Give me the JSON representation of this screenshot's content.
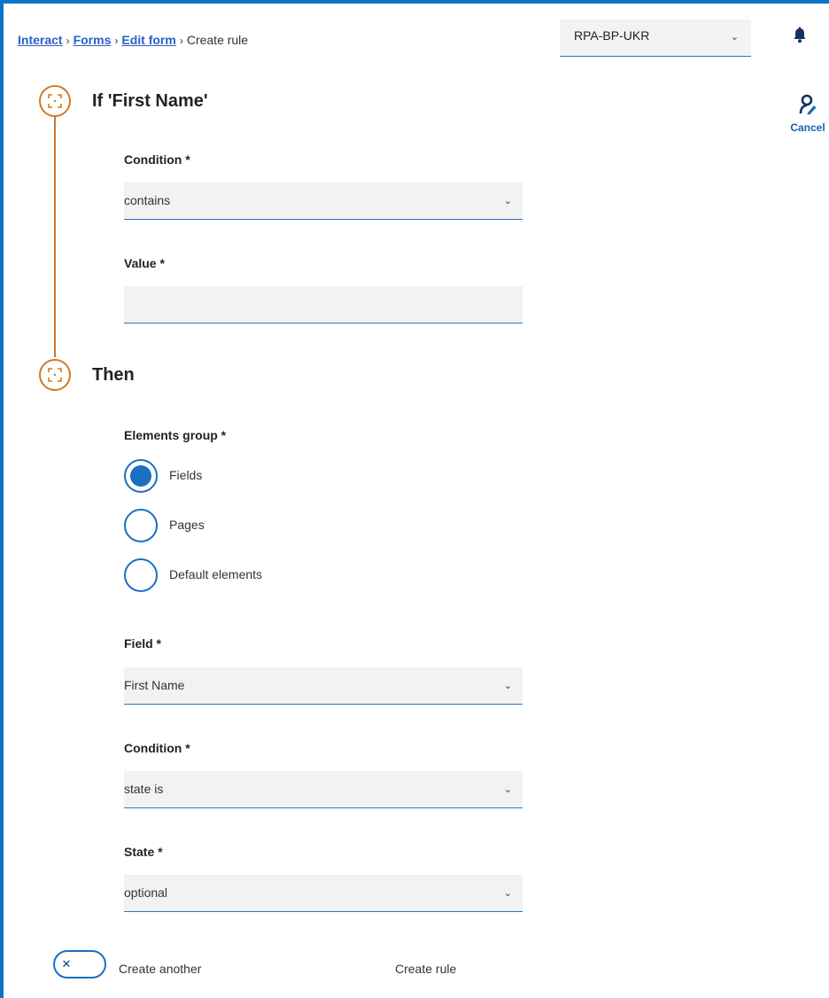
{
  "breadcrumb": {
    "items": [
      "Interact",
      "Forms",
      "Edit form"
    ],
    "separator": "›",
    "current": "Create rule"
  },
  "environment": {
    "selected": "RPA-BP-UKR"
  },
  "actions": {
    "cancel_label": "Cancel"
  },
  "if_section": {
    "title": "If 'First Name'",
    "condition": {
      "label": "Condition *",
      "value": "contains"
    },
    "value_field": {
      "label": "Value *",
      "value": ""
    }
  },
  "then_section": {
    "title": "Then",
    "elements_group": {
      "label": "Elements group *",
      "options": [
        "Fields",
        "Pages",
        "Default elements"
      ],
      "selected": "Fields"
    },
    "field": {
      "label": "Field *",
      "value": "First Name"
    },
    "condition": {
      "label": "Condition *",
      "value": "state is"
    },
    "state": {
      "label": "State *",
      "value": "optional"
    }
  },
  "footer": {
    "create_another_label": "Create another",
    "create_another_on": false,
    "create_rule_label": "Create rule"
  },
  "colors": {
    "accent_blue": "#1a6fc0",
    "step_orange": "#d07a25",
    "frame_blue": "#0a74c4",
    "input_bg": "#f2f2f2"
  },
  "icons": {
    "bell": "bell-icon",
    "cancel": "user-edit-icon",
    "step": "focus-frame-icon",
    "chevron": "chevron-down-icon",
    "toggle": "close-icon"
  }
}
